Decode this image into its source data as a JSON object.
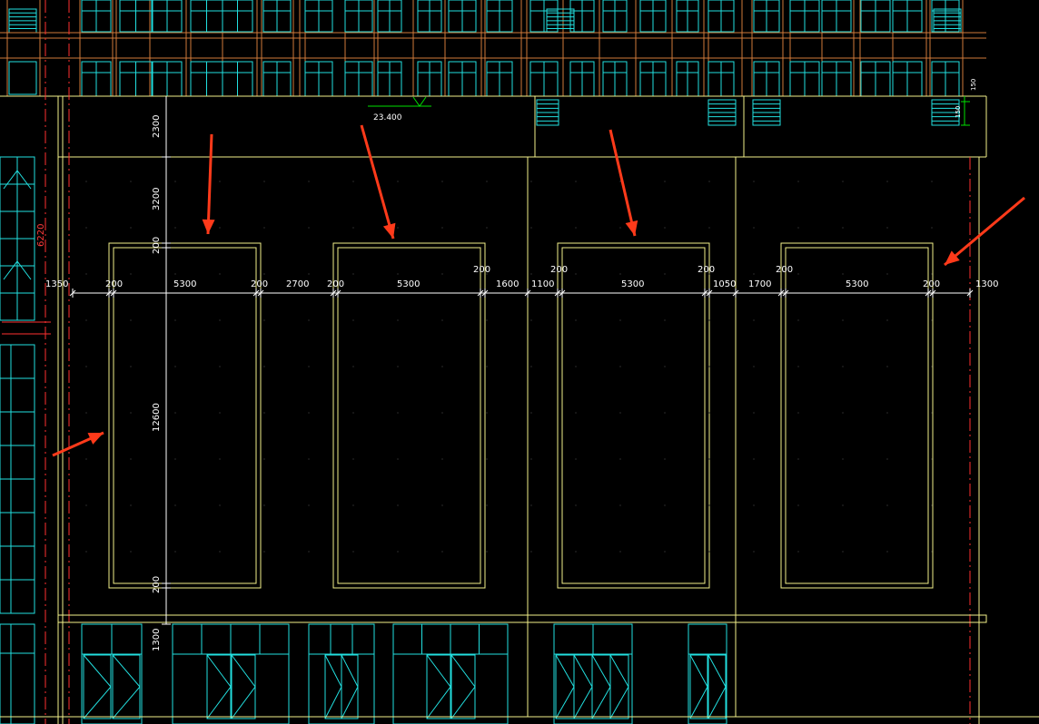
{
  "colors": {
    "background": "#000000",
    "outline": "#f2f08a",
    "window": "#22e0e0",
    "axis": "#ff3030",
    "column": "#d07a3a",
    "dimension": "#ffffff",
    "level_marker": "#00e000",
    "arrow": "#ff3a1a"
  },
  "level_mark": {
    "text": "23.400"
  },
  "top_right_small_dims": {
    "a": "150",
    "b": "150"
  },
  "side_label": {
    "text": "6220"
  },
  "horizontal_dims": {
    "d1": "1350",
    "d2": "200",
    "d3": "5300",
    "d4": "200",
    "d5": "2700",
    "d6": "200",
    "d7": "5300",
    "d8": "200",
    "d9": "1600",
    "d10": "1100",
    "d11": "200",
    "d12": "5300",
    "d13": "200",
    "d14": "1050",
    "d15": "1700",
    "d16": "200",
    "d17": "5300",
    "d18": "200",
    "d19": "1300"
  },
  "vertical_dims": {
    "v1": "2300",
    "v2": "3200",
    "v3": "200",
    "v4": "12600",
    "v5": "200",
    "v6": "1300"
  },
  "annotations": [
    {
      "icon": "red-arrow",
      "points_to": "panel-1-top"
    },
    {
      "icon": "red-arrow",
      "points_to": "panel-2-top"
    },
    {
      "icon": "red-arrow",
      "points_to": "panel-3-top"
    },
    {
      "icon": "red-arrow",
      "points_to": "panel-4-top-right"
    },
    {
      "icon": "red-arrow",
      "points_to": "panel-1-left"
    }
  ]
}
